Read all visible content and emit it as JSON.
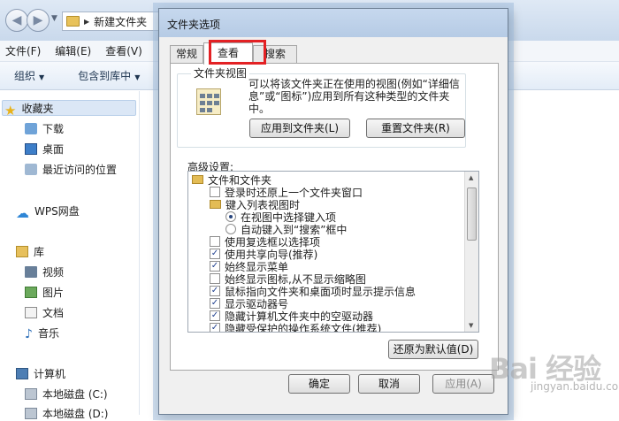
{
  "explorer": {
    "address": "新建文件夹",
    "menu": [
      "文件(F)",
      "编辑(E)",
      "查看(V)"
    ],
    "toolbar": [
      "组织",
      "包含到库中"
    ],
    "nav": {
      "favorites": "收藏夹",
      "downloads": "下载",
      "desktop": "桌面",
      "recent": "最近访问的位置",
      "wps": "WPS网盘",
      "library": "库",
      "videos": "视频",
      "pictures": "图片",
      "documents": "文档",
      "music": "音乐",
      "computer": "计算机",
      "disk_c": "本地磁盘 (C:)",
      "disk_d": "本地磁盘 (D:)"
    }
  },
  "dialog": {
    "title": "文件夹选项",
    "tabs": [
      "常规",
      "查看",
      "搜索"
    ],
    "active_tab": "查看",
    "folder_view": {
      "label": "文件夹视图",
      "description": "可以将该文件夹正在使用的视图(例如“详细信息”或“图标”)应用到所有这种类型的文件夹中。",
      "apply_button": "应用到文件夹(L)",
      "reset_button": "重置文件夹(R)"
    },
    "advanced_label": "高级设置:",
    "advanced_items": [
      {
        "kind": "folder",
        "label": "文件和文件夹"
      },
      {
        "kind": "checkbox",
        "checked": false,
        "label": "登录时还原上一个文件夹窗口"
      },
      {
        "kind": "folder",
        "label": "键入列表视图时"
      },
      {
        "kind": "radio",
        "checked": true,
        "label": "在视图中选择键入项"
      },
      {
        "kind": "radio",
        "checked": false,
        "label": "自动键入到“搜索”框中"
      },
      {
        "kind": "checkbox",
        "checked": false,
        "label": "使用复选框以选择项"
      },
      {
        "kind": "checkbox",
        "checked": true,
        "label": "使用共享向导(推荐)"
      },
      {
        "kind": "checkbox",
        "checked": true,
        "label": "始终显示菜单"
      },
      {
        "kind": "checkbox",
        "checked": false,
        "label": "始终显示图标,从不显示缩略图"
      },
      {
        "kind": "checkbox",
        "checked": true,
        "label": "鼠标指向文件夹和桌面项时显示提示信息"
      },
      {
        "kind": "checkbox",
        "checked": true,
        "label": "显示驱动器号"
      },
      {
        "kind": "checkbox",
        "checked": true,
        "label": "隐藏计算机文件夹中的空驱动器"
      },
      {
        "kind": "checkbox",
        "checked": true,
        "label": "隐藏受保护的操作系统文件(推荐)"
      }
    ],
    "restore_button": "还原为默认值(D)",
    "ok_button": "确定",
    "cancel_button": "取消",
    "apply_button": "应用(A)"
  },
  "watermark": "Bai 经验",
  "watermark_sub": "jingyan.baidu.com"
}
